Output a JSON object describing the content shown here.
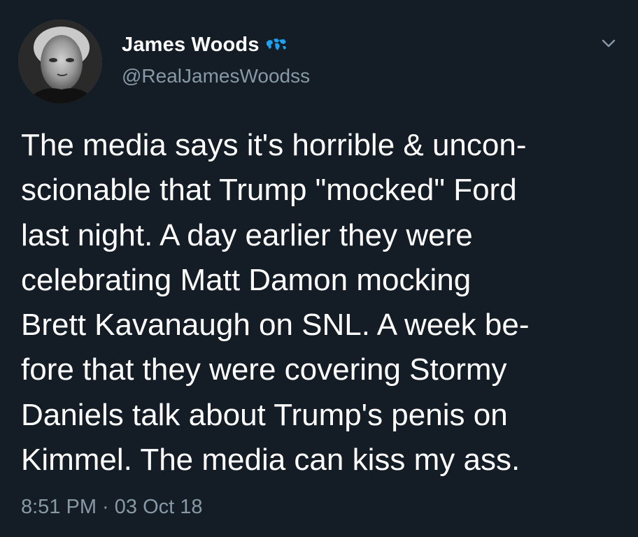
{
  "tweet": {
    "author": {
      "display_name": "James Woods",
      "handle": "@RealJamesWoodss",
      "badge_icon": "world-map-badge-icon",
      "avatar": "avatar-photo"
    },
    "menu_icon": "chevron-down-icon",
    "text_lines": [
      "The media says it's horrible & uncon-",
      "scionable that Trump \"mocked\" Ford",
      "last night. A day earlier they were",
      "celebrating Matt Damon mocking",
      "Brett Kavanaugh on SNL. A week be-",
      "fore that they were covering Stormy",
      "Daniels talk about Trump's penis on",
      "Kimmel. The media can kiss my ass."
    ],
    "timestamp": "8:51 PM · 03 Oct 18"
  },
  "colors": {
    "background": "#141d26",
    "text": "#ffffff",
    "secondary_text": "#8899a6",
    "badge": "#1da1f2"
  }
}
